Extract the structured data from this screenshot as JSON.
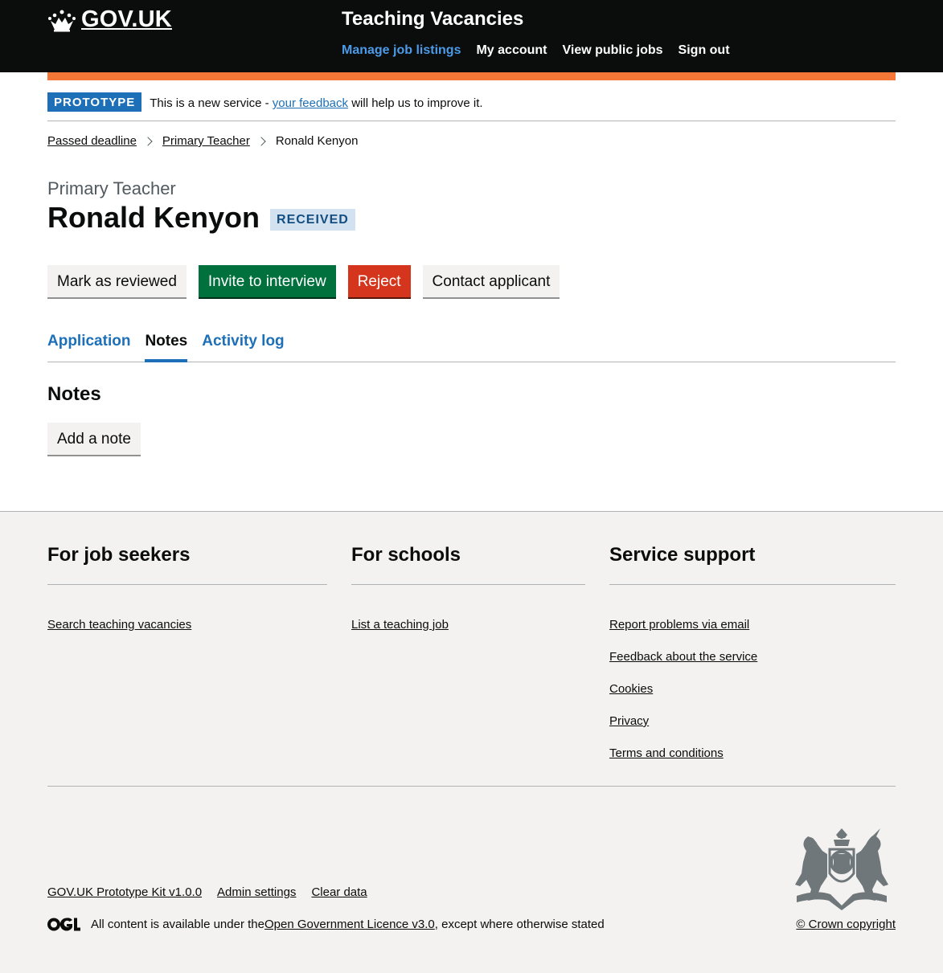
{
  "header": {
    "logo_text": "GOV.UK",
    "service_name": "Teaching Vacancies",
    "nav": [
      {
        "label": "Manage job listings",
        "active": true
      },
      {
        "label": "My account",
        "active": false
      },
      {
        "label": "View public jobs",
        "active": false
      },
      {
        "label": "Sign out",
        "active": false
      }
    ]
  },
  "phase_banner": {
    "tag": "PROTOTYPE",
    "text_before": "This is a new service - ",
    "link": "your feedback",
    "text_after": " will help us to improve it."
  },
  "breadcrumbs": [
    "Passed deadline",
    "Primary Teacher",
    "Ronald Kenyon"
  ],
  "page": {
    "caption": "Primary Teacher",
    "title": "Ronald Kenyon",
    "status": "RECEIVED"
  },
  "actions": {
    "mark_reviewed": "Mark as reviewed",
    "invite": "Invite to interview",
    "reject": "Reject",
    "contact": "Contact applicant"
  },
  "tabs": [
    {
      "label": "Application",
      "selected": false
    },
    {
      "label": "Notes",
      "selected": true
    },
    {
      "label": "Activity log",
      "selected": false
    }
  ],
  "notes": {
    "heading": "Notes",
    "add_button": "Add a note"
  },
  "footer": {
    "columns": [
      {
        "heading": "For job seekers",
        "links": [
          "Search teaching vacancies"
        ]
      },
      {
        "heading": "For schools",
        "links": [
          "List a teaching job"
        ]
      },
      {
        "heading": "Service support",
        "links": [
          "Report problems via email",
          "Feedback about the service",
          "Cookies",
          "Privacy",
          "Terms and conditions"
        ]
      }
    ],
    "meta_links": [
      "GOV.UK Prototype Kit v1.0.0",
      "Admin settings",
      "Clear data"
    ],
    "licence_before": "All content is available under the ",
    "licence_link": "Open Government Licence v3.0",
    "licence_after": ", except where otherwise stated",
    "copyright": "© Crown copyright"
  },
  "colors": {
    "header_bg": "#0b0c0c",
    "link_blue": "#1d70b8",
    "orange": "#f47738",
    "green": "#00703c",
    "red": "#d4351c",
    "footer_bg": "#f3f2f1"
  }
}
